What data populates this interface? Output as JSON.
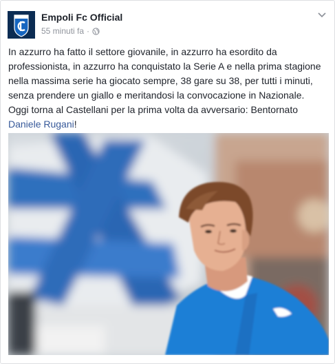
{
  "post": {
    "page_name": "Empoli Fc Official",
    "timestamp": "55 minuti fa",
    "separator": "·",
    "privacy_icon": "globe-icon",
    "menu_icon": "chevron-down-icon",
    "text_main": "In azzurro ha fatto il settore giovanile, in azzurro ha esordito da professionista, in azzurro ha conquistato la Serie A e nella prima stagione nella massima serie ha giocato sempre, 38 gare su 38, per tutti i minuti, senza prendere un giallo e meritandosi la convocazione in Nazionale. Oggi torna al Castellani per la prima volta da avversario: Bentornato ",
    "mention": "Daniele Rugani",
    "text_end": "!"
  },
  "colors": {
    "link": "#365899",
    "name": "#1d2129",
    "meta": "#90949c",
    "avatar_bg": "#0b2c53",
    "jersey": "#1f7fd6"
  }
}
